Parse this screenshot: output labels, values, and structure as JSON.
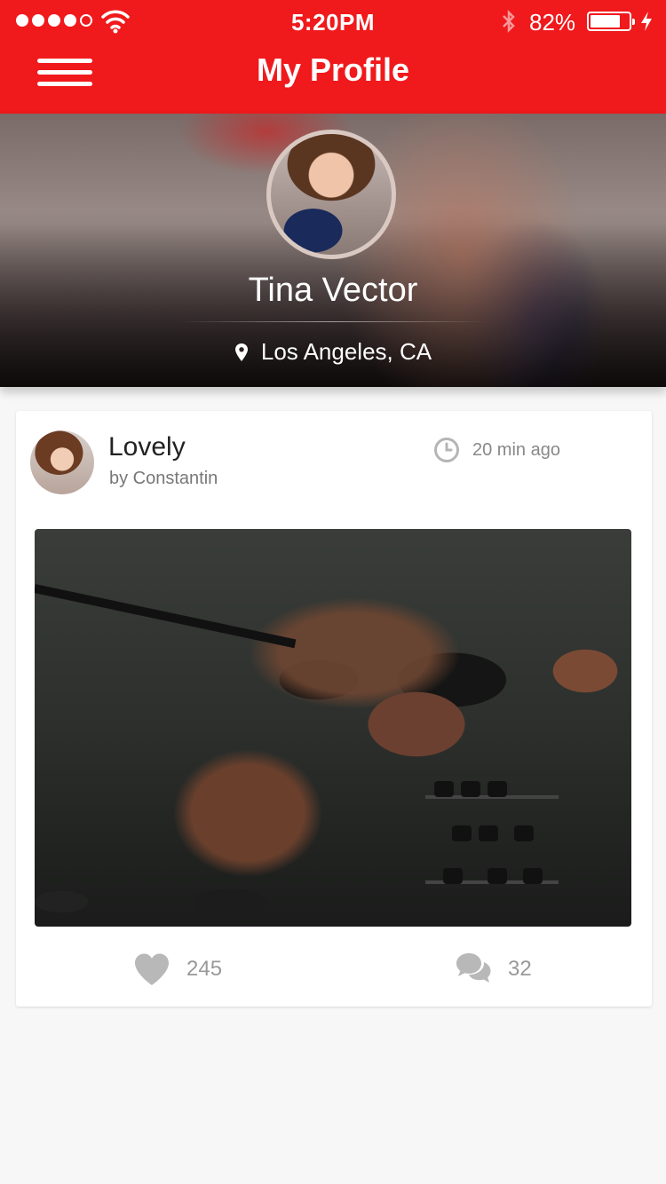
{
  "status_bar": {
    "time": "5:20PM",
    "battery_percent": "82%",
    "battery_level": 0.82,
    "signal_bars_filled": 4,
    "signal_bars_total": 5
  },
  "nav": {
    "title": "My Profile",
    "menu_icon": "hamburger-menu-icon"
  },
  "profile": {
    "name": "Tina Vector",
    "location": "Los Angeles, CA",
    "location_icon": "location-pin-icon"
  },
  "post": {
    "title": "Lovely",
    "author": "by Constantin",
    "time_ago": "20 min ago",
    "time_icon": "clock-icon",
    "likes": "245",
    "comments": "32",
    "like_icon": "heart-icon",
    "comment_icon": "comments-icon"
  },
  "colors": {
    "brand_red": "#f0191c",
    "background": "#f7f7f7",
    "muted_text": "#999999"
  }
}
